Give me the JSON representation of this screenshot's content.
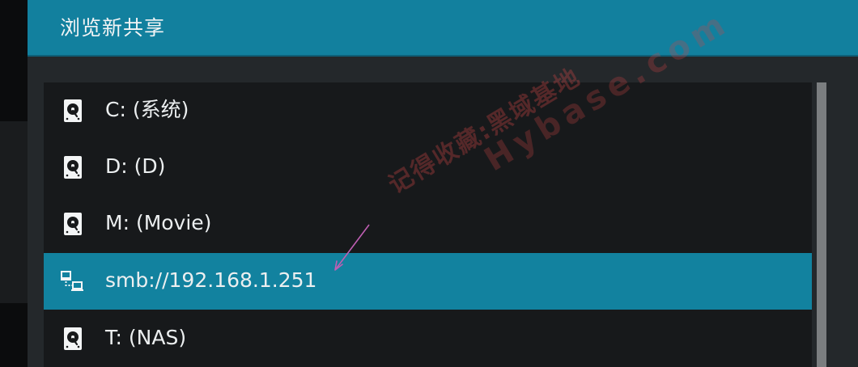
{
  "dialog": {
    "title": "浏览新共享"
  },
  "items": [
    {
      "label": "C: (系统)",
      "icon": "hard-drive-icon"
    },
    {
      "label": "D: (D)",
      "icon": "hard-drive-icon"
    },
    {
      "label": "M: (Movie)",
      "icon": "hard-drive-icon"
    },
    {
      "label": "smb://192.168.1.251",
      "icon": "network-icon",
      "selected": true
    },
    {
      "label": "T: (NAS)",
      "icon": "hard-drive-icon"
    }
  ],
  "watermark": {
    "line1": "记得收藏:黑域基地",
    "line2": "Hybase.com"
  },
  "colors": {
    "header": "#12809e",
    "selected_row": "#12829f",
    "list_background": "#17191b",
    "dialog_background": "#24282b",
    "annotation_arrow": "#c05fb4"
  }
}
